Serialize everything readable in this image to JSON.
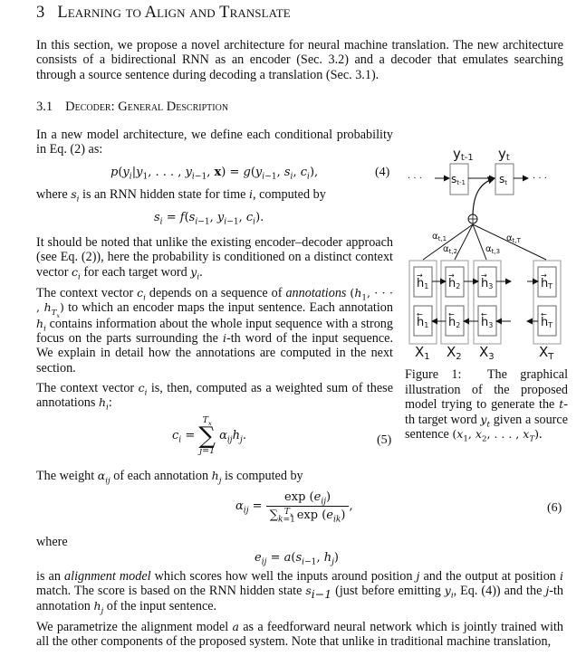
{
  "section": {
    "number": "3",
    "title": "Learning to Align and Translate",
    "intro": "In this section, we propose a novel architecture for neural machine translation. The new architecture consists of a bidirectional RNN as an encoder (Sec. 3.2) and a decoder that emulates searching through a source sentence during decoding a translation (Sec. 3.1)."
  },
  "subsection": {
    "number": "3.1",
    "title": "Decoder: General Description"
  },
  "paragraphs": {
    "p1": "In a new model architecture, we define each conditional probability in Eq. (2) as:",
    "p2_pre": "where ",
    "p2_post": " is an RNN hidden state for time ",
    "p2_end": ", computed by",
    "p3_a": "It should be noted that unlike the existing encoder–decoder approach (see Eq. (2)), here the probability is conditioned on a distinct context vector ",
    "p3_b": " for each target word ",
    "p3_c": ".",
    "p4_a": "The context vector ",
    "p4_b": " depends on a sequence of ",
    "p4_em": "annotations",
    "p4_c": " to which an encoder maps the input sentence. Each annotation ",
    "p4_d": " contains information about the whole input sequence with a strong focus on the parts surrounding the ",
    "p4_e": "-th word of the input sequence. We explain in detail how the annotations are computed in the next section.",
    "p5_a": "The context vector ",
    "p5_b": " is, then, computed as a weighted sum of these annotations ",
    "p5_c": ":",
    "p6_a": "The weight ",
    "p6_b": " of each annotation ",
    "p6_c": " is computed by",
    "p7": "where",
    "p8_a": "is an ",
    "p8_em": "alignment model",
    "p8_b": " which scores how well the inputs around position ",
    "p8_c": " and the output at position ",
    "p8_d": " match. The score is based on the RNN hidden state ",
    "p8_e": " (just before emitting ",
    "p8_f": ", Eq. (4)) and the ",
    "p8_g": "-th annotation ",
    "p8_h": " of the input sentence.",
    "p9_a": "We parametrize the alignment model ",
    "p9_b": " as a feedforward neural network which is jointly trained with all the other components of the proposed system. Note that unlike in traditional machine translation,"
  },
  "equations": {
    "eq4": {
      "lhs": "p(y_i|y_1, …, y_{i−1}, x)",
      "rhs": "g(y_{i−1}, s_i, c_i),",
      "number": "(4)"
    },
    "eq_s": {
      "text": "s_i = f(s_{i−1}, y_{i−1}, c_i)."
    },
    "eq5": {
      "text": "c_i = Σ_{j=1}^{T_x} α_ij h_j.",
      "number": "(5)"
    },
    "eq6": {
      "text": "α_ij = exp(e_ij) / Σ_{k=1}^{T_x} exp(e_ik),",
      "number": "(6)"
    },
    "eq_e": {
      "text": "e_ij = a(s_{i−1}, h_j)"
    }
  },
  "figure": {
    "caption_label": "Figure 1:",
    "caption_a": "The graphical illustration of the proposed model trying to generate the ",
    "caption_b": "-th target word ",
    "caption_c": " given a source sentence ",
    "caption_d": ".",
    "outputs": [
      "y",
      "y"
    ],
    "output_subs": [
      "t-1",
      "t"
    ],
    "states": [
      "s",
      "s"
    ],
    "state_subs": [
      "t-1",
      "t"
    ],
    "weights": [
      "α",
      "α",
      "α",
      "α"
    ],
    "weight_subs": [
      "t,1",
      "t,2",
      "t,3",
      "t,T"
    ],
    "inputs": [
      "X",
      "X",
      "X",
      "X"
    ],
    "input_subs": [
      "1",
      "2",
      "3",
      "T"
    ],
    "hidden": "h",
    "hidden_subs": [
      "1",
      "2",
      "3",
      "T"
    ],
    "ellipsis": "· · ·",
    "sum_symbol": "⊕"
  }
}
